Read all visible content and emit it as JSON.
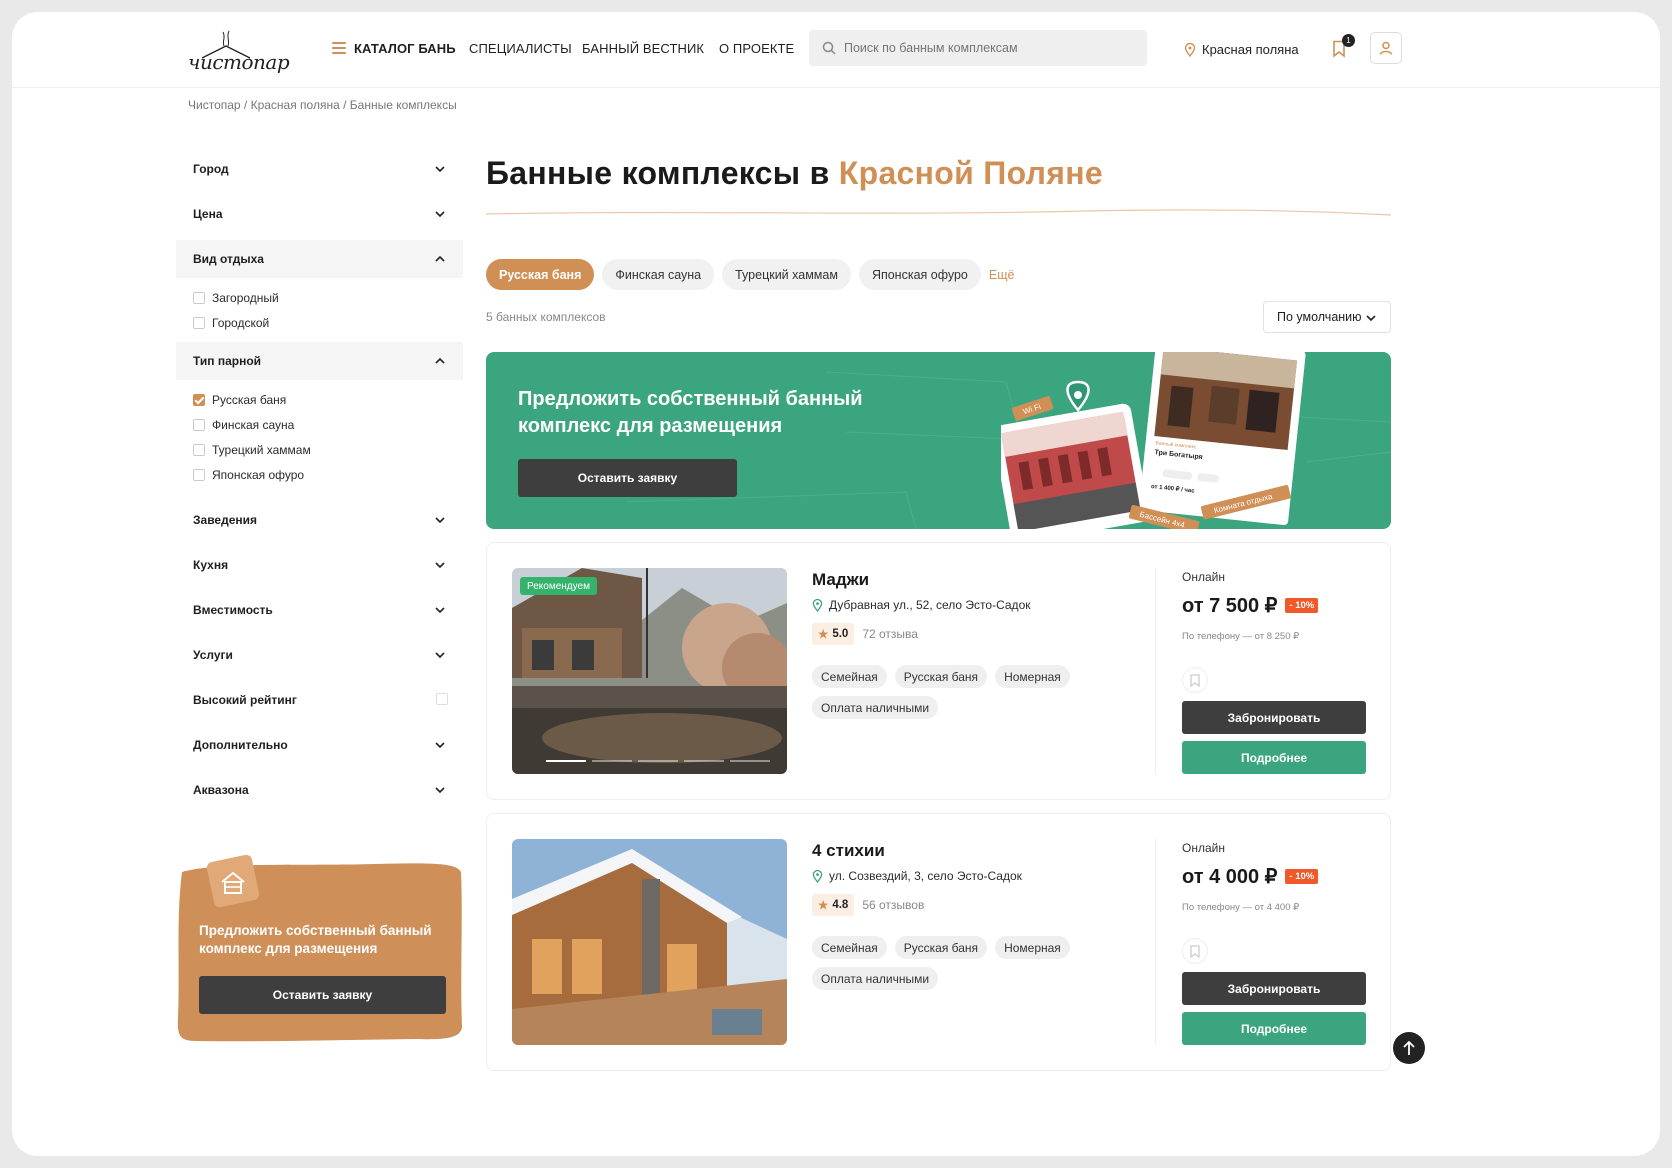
{
  "header": {
    "logo_text": "чистопар",
    "nav": {
      "catalog": "КАТАЛОГ БАНЬ",
      "specialists": "СПЕЦИАЛИСТЫ",
      "journal": "БАННЫЙ ВЕСТНИК",
      "about": "О ПРОЕКТЕ"
    },
    "search_placeholder": "Поиск по банным комплексам",
    "city": "Красная поляна",
    "bookmarks_count": "1"
  },
  "breadcrumb": "Чистопар / Красная поляна / Банные комплексы",
  "sidebar": {
    "city": "Город",
    "price": "Цена",
    "rest_type": {
      "label": "Вид отдыха",
      "options": [
        "Загородный",
        "Городской"
      ]
    },
    "steam_type": {
      "label": "Тип парной",
      "options": [
        "Русская баня",
        "Финская сауна",
        "Турецкий хаммам",
        "Японская офуро"
      ],
      "checked": "Русская баня"
    },
    "venues": "Заведения",
    "kitchen": "Кухня",
    "capacity": "Вместимость",
    "services": "Услуги",
    "high_rating": "Высокий рейтинг",
    "extra": "Дополнительно",
    "aquazone": "Аквазона",
    "promo": {
      "title": "Предложить собственный банный комплекс для размещения",
      "button": "Оставить заявку"
    }
  },
  "main": {
    "title_prefix": "Банные комплексы в ",
    "title_accent": "Красной Поляне",
    "chips": [
      "Русская баня",
      "Финская сауна",
      "Турецкий хаммам",
      "Японская офуро"
    ],
    "chips_more": "Ещё",
    "count": "5 банных комплексов",
    "sort": "По умолчанию",
    "promo": {
      "title": "Предложить собственный банный комплекс для размещения",
      "button": "Оставить заявку",
      "card_tag_wifi": "Wi Fi",
      "card_tag_room": "Комната отдыха",
      "card_tag_pool": "Бассейн 4x4",
      "card_name": "Три Богатыря",
      "card_price": "от 1 400 ₽ / час"
    },
    "cards": [
      {
        "badge": "Рекомендуем",
        "name": "Маджи",
        "address": "Дубравная ул., 52, село Эсто-Садок",
        "rating": "5.0",
        "reviews": "72 отзыва",
        "tags": [
          "Семейная",
          "Русская баня",
          "Номерная",
          "Оплата наличными"
        ],
        "online": "Онлайн",
        "price": "от 7 500 ₽",
        "discount": "- 10%",
        "phone": "По телефону — от 8 250 ₽",
        "book": "Забронировать",
        "more": "Подробнее"
      },
      {
        "badge": "",
        "name": "4 стихии",
        "address": "ул. Созвездий, 3, село Эсто-Садок",
        "rating": "4.8",
        "reviews": "56 отзывов",
        "tags": [
          "Семейная",
          "Русская баня",
          "Номерная",
          "Оплата наличными"
        ],
        "online": "Онлайн",
        "price": "от 4 000 ₽",
        "discount": "- 10%",
        "phone": "По телефону — от 4 400 ₽",
        "book": "Забронировать",
        "more": "Подробнее"
      }
    ]
  },
  "colors": {
    "accent": "#d08f55",
    "green": "#3aa57e",
    "dark": "#3e3e3e",
    "discount": "#f05a28"
  }
}
